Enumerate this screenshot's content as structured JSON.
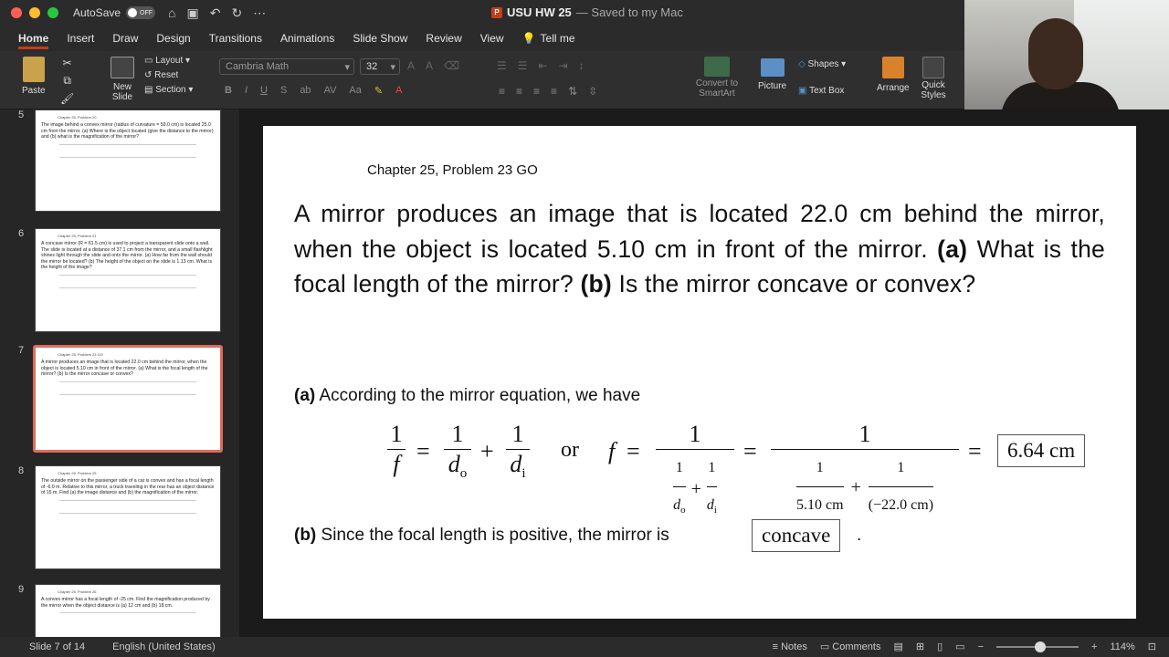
{
  "titlebar": {
    "autosave_label": "AutoSave",
    "autosave_state": "OFF",
    "doc_name": "USU HW 25",
    "saved_status": "— Saved to my Mac"
  },
  "tabs": [
    "Home",
    "Insert",
    "Draw",
    "Design",
    "Transitions",
    "Animations",
    "Slide Show",
    "Review",
    "View"
  ],
  "tell_me": "Tell me",
  "ribbon": {
    "paste": "Paste",
    "new_slide": "New Slide",
    "layout": "Layout",
    "reset": "Reset",
    "section": "Section",
    "font_name": "Cambria Math",
    "font_size": "32",
    "convert_smartart": "Convert to SmartArt",
    "picture": "Picture",
    "shapes": "Shapes",
    "text_box": "Text Box",
    "arrange": "Arrange",
    "quick_styles": "Quick Styles"
  },
  "thumbnails": [
    {
      "num": "5",
      "chapter": "Chapter 25, Problem 20",
      "text": "The image behind a convex mirror (radius of curvature = 59.0 cm) is located 25.0 cm from the mirror. (a) Where is the object located (give the distance to the mirror) and (b) what is the magnification of the mirror?"
    },
    {
      "num": "6",
      "chapter": "Chapter 25, Problem 21",
      "text": "A concave mirror (R = 61.5 cm) is used to project a transparent slide onto a wall. The slide is located at a distance of 37.1 cm from the mirror, and a small flashlight shines light through the slide and onto the mirror. (a) How far from the wall should the mirror be located? (b) The height of the object on the slide is 1.13 cm. What is the height of the image?"
    },
    {
      "num": "7",
      "chapter": "Chapter 25, Problem 23 GO",
      "text": "A mirror produces an image that is located 22.0 cm behind the mirror, when the object is located 5.10 cm in front of the mirror. (a) What is the focal length of the mirror? (b) Is the mirror concave or convex?"
    },
    {
      "num": "8",
      "chapter": "Chapter 25, Problem 25",
      "text": "The outside mirror on the passenger side of a car is convex and has a focal length of -6.0 m. Relative to this mirror, a truck traveling in the rear has an object distance of 15 m. Find (a) the image distance and (b) the magnification of the mirror."
    },
    {
      "num": "9",
      "chapter": "Chapter 25, Problem 26",
      "text": "A convex mirror has a focal length of -25 cm. Find the magnification produced by the mirror when the object distance is (a) 12 cm and (b) 18 cm."
    }
  ],
  "slide": {
    "chapter": "Chapter 25, Problem 23 GO",
    "problem_pre": "A mirror produces an image that is located 22.0 cm behind the mirror, when the object is located 5.10 cm in front of the mirror.",
    "a_label": "(a)",
    "a_question": "What is the focal length of the mirror?",
    "b_label": "(b)",
    "b_question": "Is the mirror concave or convex?",
    "part_a_text": "According to the mirror equation, we have",
    "eq_or": "or",
    "eq_d5": "5.10 cm",
    "eq_d22": "(−22.0 cm)",
    "answer_a": "6.64 cm",
    "part_b_text": "Since the focal length is positive, the mirror is",
    "answer_b": "concave"
  },
  "status": {
    "slide_info": "Slide 7 of 14",
    "language": "English (United States)",
    "notes": "Notes",
    "comments": "Comments",
    "zoom": "114%"
  }
}
